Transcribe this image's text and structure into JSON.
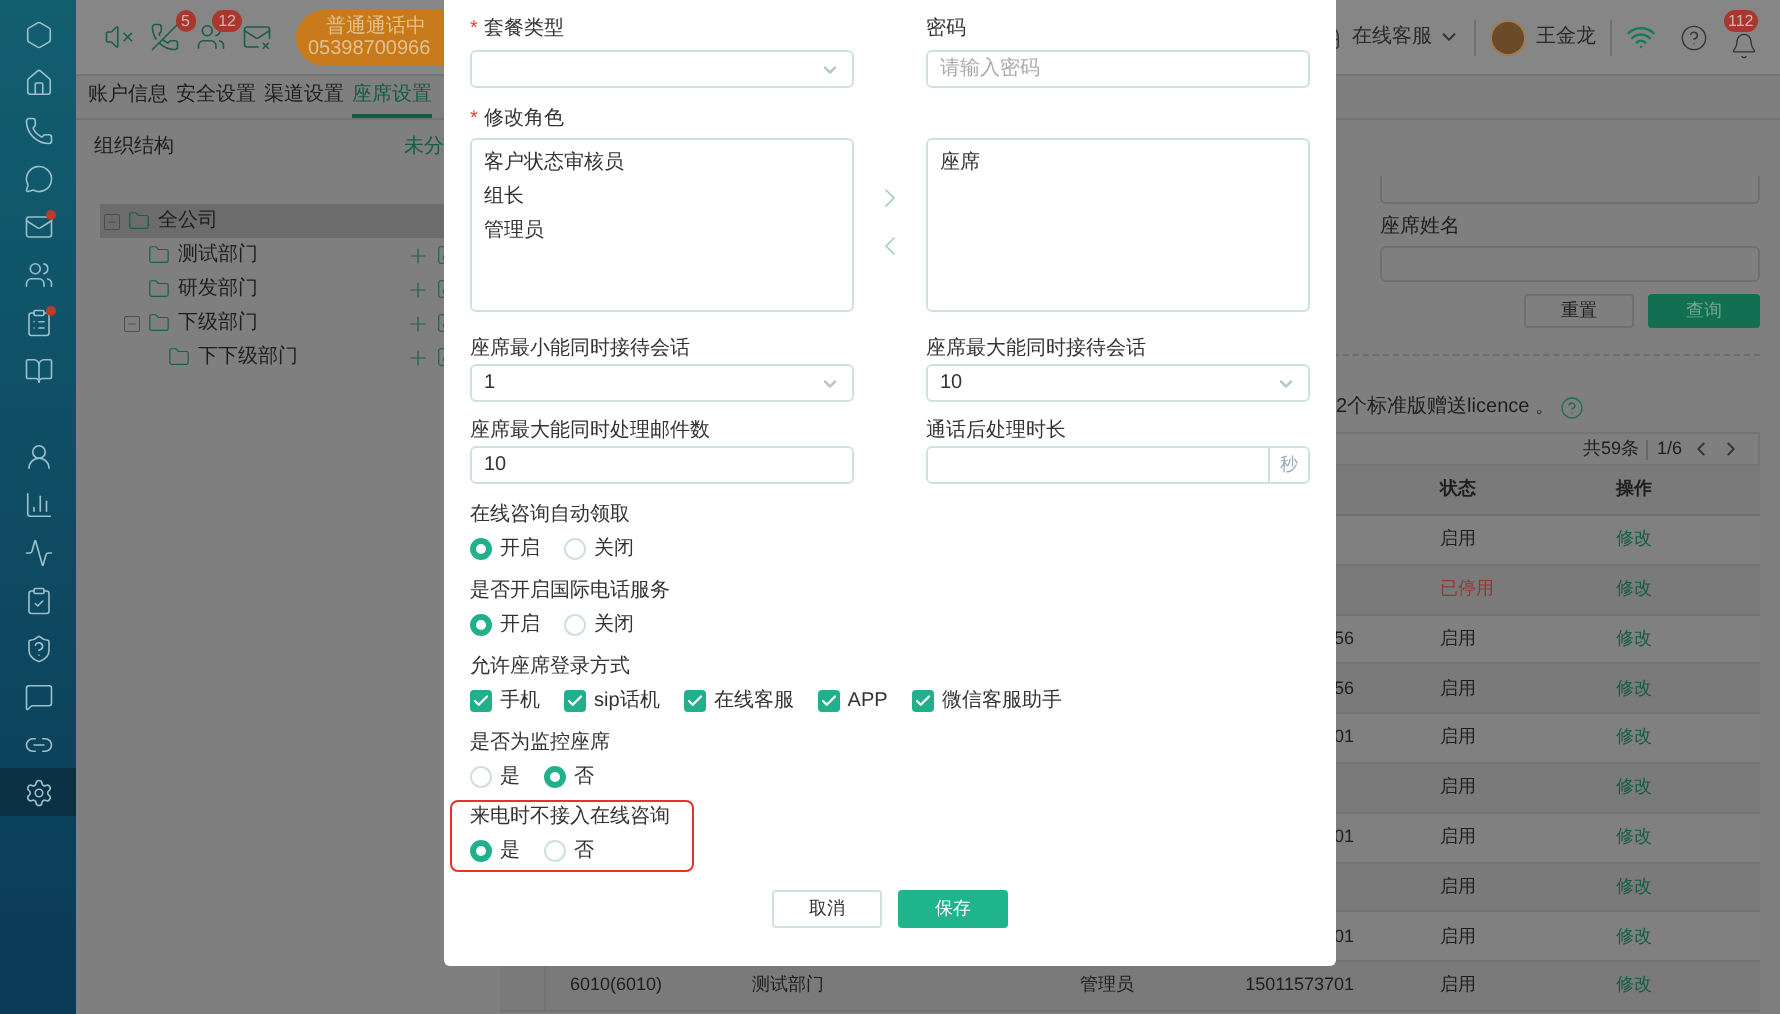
{
  "sidebar": {
    "items": [
      {
        "kind": "logo",
        "selected": false,
        "alert": false
      },
      {
        "kind": "home",
        "selected": false,
        "alert": false
      },
      {
        "kind": "phone",
        "selected": false,
        "alert": false
      },
      {
        "kind": "chat",
        "selected": false,
        "alert": false
      },
      {
        "kind": "mail",
        "selected": false,
        "alert": true
      },
      {
        "kind": "users",
        "selected": false,
        "alert": false
      },
      {
        "kind": "clipboard",
        "selected": false,
        "alert": true
      },
      {
        "kind": "book",
        "selected": false,
        "alert": false
      },
      {
        "kind": "agent",
        "selected": false,
        "alert": false
      },
      {
        "kind": "chart",
        "selected": false,
        "alert": false
      },
      {
        "kind": "monitor",
        "selected": false,
        "alert": false
      },
      {
        "kind": "checklist",
        "selected": false,
        "alert": false
      },
      {
        "kind": "shield",
        "selected": false,
        "alert": false
      },
      {
        "kind": "message",
        "selected": false,
        "alert": false
      },
      {
        "kind": "link",
        "selected": false,
        "alert": false
      },
      {
        "kind": "settings",
        "selected": true,
        "alert": false
      }
    ]
  },
  "header": {
    "indicators": [
      {
        "kind": "speaker"
      },
      {
        "kind": "call",
        "badge": "5"
      },
      {
        "kind": "contacts",
        "badge": "12"
      },
      {
        "kind": "mail"
      }
    ],
    "call": {
      "status": "普通通话中",
      "number": "05398700966"
    },
    "service": "在线客服",
    "user": "王金龙",
    "notifications": "112"
  },
  "tabs": [
    {
      "label": "账户信息",
      "selected": false
    },
    {
      "label": "安全设置",
      "selected": false
    },
    {
      "label": "渠道设置",
      "selected": false
    },
    {
      "label": "座席设置",
      "selected": true
    }
  ],
  "org": {
    "title": "组织结构",
    "link": "未分",
    "tree": [
      {
        "label": "全公司",
        "expanded": true,
        "selected": true,
        "children": [
          {
            "label": "测试部门"
          },
          {
            "label": "研发部门"
          },
          {
            "label": "下级部门",
            "expanded": true,
            "selected": false,
            "children": [
              {
                "label": "下下级部门"
              }
            ]
          }
        ]
      }
    ]
  },
  "search": {
    "name_label": "座席姓名",
    "reset": "重置",
    "query": "查询"
  },
  "licence_note": "2个标准版赠送licence 。",
  "table": {
    "total": "共59条",
    "page": "1/6",
    "columns": [
      "状态",
      "操作"
    ],
    "rows": [
      {
        "status": "启用",
        "stopped": false,
        "action": "修改"
      },
      {
        "status": "已停用",
        "stopped": true,
        "action": "修改"
      },
      {
        "phone": "56",
        "status": "启用",
        "stopped": false,
        "action": "修改"
      },
      {
        "phone": "56",
        "status": "启用",
        "stopped": false,
        "action": "修改"
      },
      {
        "phone": "01",
        "status": "启用",
        "stopped": false,
        "action": "修改"
      },
      {
        "status": "启用",
        "stopped": false,
        "action": "修改"
      },
      {
        "phone": "01",
        "status": "启用",
        "stopped": false,
        "action": "修改"
      },
      {
        "status": "启用",
        "stopped": false,
        "action": "修改"
      },
      {
        "phone": "01",
        "status": "启用",
        "stopped": false,
        "action": "修改"
      },
      {
        "account": "6010(6010)",
        "department": "测试部门",
        "role": "管理员",
        "phone": "15011573701",
        "status": "启用",
        "stopped": false,
        "action": "修改"
      }
    ]
  },
  "dialog": {
    "package_type": {
      "label": "套餐类型",
      "required_mark": "*"
    },
    "password": {
      "label": "密码",
      "placeholder": "请输入密码"
    },
    "roles": {
      "label": "修改角色",
      "required_mark": "*",
      "available": [
        "客户状态审核员",
        "组长",
        "管理员"
      ],
      "assigned": [
        "座席"
      ]
    },
    "pairs": [
      [
        {
          "kind": "select",
          "label": "座席最小能同时接待会话",
          "value": "1"
        },
        {
          "kind": "select",
          "label": "座席最大能同时接待会话",
          "value": "10"
        }
      ],
      [
        {
          "kind": "input",
          "label": "座席最大能同时处理邮件数",
          "value": "10"
        },
        {
          "kind": "unit",
          "label": "通话后处理时长",
          "unit": "秒"
        }
      ]
    ],
    "settings": [
      {
        "kind": "radio",
        "label": "在线咨询自动领取",
        "options": [
          {
            "label": "开启",
            "selected": true
          },
          {
            "label": "关闭",
            "selected": false
          }
        ]
      },
      {
        "kind": "radio",
        "label": "是否开启国际电话服务",
        "options": [
          {
            "label": "开启",
            "selected": true
          },
          {
            "label": "关闭",
            "selected": false
          }
        ]
      },
      {
        "kind": "checkbox",
        "label": "允许座席登录方式",
        "options": [
          {
            "label": "手机",
            "checked": true
          },
          {
            "label": "sip话机",
            "checked": true
          },
          {
            "label": "在线客服",
            "checked": true
          },
          {
            "label": "APP",
            "checked": true
          },
          {
            "label": "微信客服助手",
            "checked": true
          }
        ]
      },
      {
        "kind": "radio",
        "label": "是否为监控座席",
        "options": [
          {
            "label": "是",
            "selected": false
          },
          {
            "label": "否",
            "selected": true
          }
        ]
      },
      {
        "kind": "radio",
        "label": "来电时不接入在线咨询",
        "highlighted": true,
        "options": [
          {
            "label": "是",
            "selected": true
          },
          {
            "label": "否",
            "selected": false
          }
        ]
      }
    ],
    "buttons": [
      {
        "label": "取消",
        "kind": "secondary"
      },
      {
        "label": "保存",
        "kind": "primary"
      }
    ]
  }
}
